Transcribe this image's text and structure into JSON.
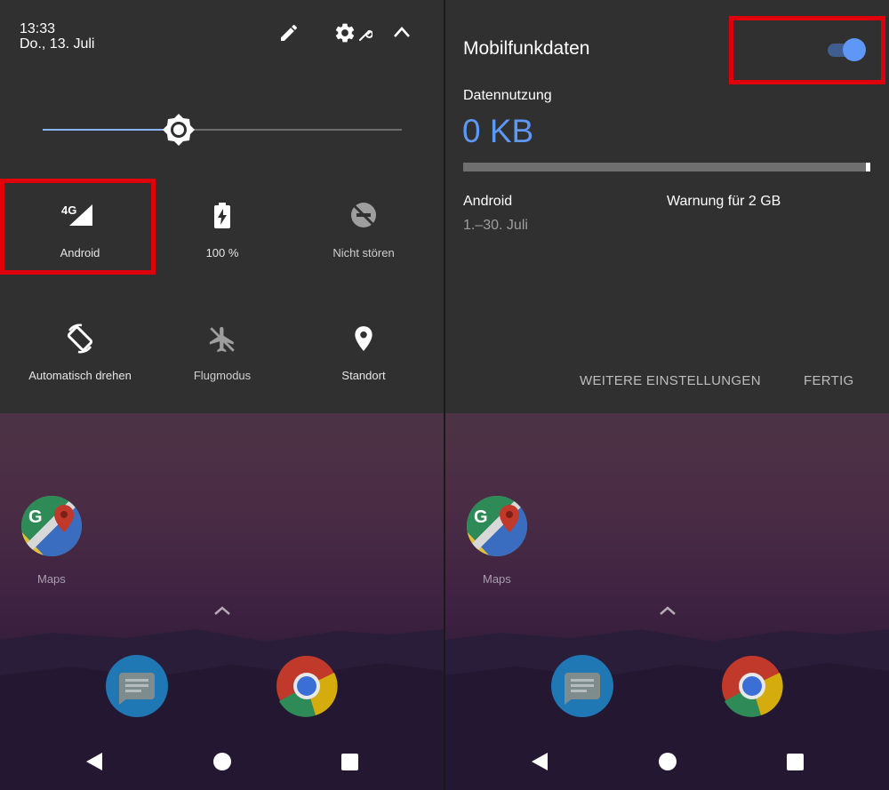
{
  "left": {
    "status": {
      "time": "13:33",
      "date": "Do., 13. Juli"
    },
    "header_icons": [
      "edit-icon",
      "settings-icon",
      "collapse-icon"
    ],
    "brightness": {
      "level": 0.38
    },
    "tiles": [
      {
        "label": "Android",
        "icon": "mobile-data-4g-icon",
        "badge": "4G",
        "highlighted": true
      },
      {
        "label": "100 %",
        "icon": "battery-icon"
      },
      {
        "label": "Nicht stören",
        "icon": "do-not-disturb-icon"
      },
      {
        "label": "Automatisch drehen",
        "icon": "auto-rotate-icon"
      },
      {
        "label": "Flugmodus",
        "icon": "airplane-icon"
      },
      {
        "label": "Standort",
        "icon": "location-icon"
      }
    ]
  },
  "right": {
    "title": "Mobilfunkdaten",
    "toggle": {
      "on": true,
      "highlighted": true
    },
    "usage_label": "Datennutzung",
    "usage_value": "0 KB",
    "usage_fraction": 0.0,
    "network": "Android",
    "period": "1.–30. Juli",
    "warning": "Warnung für 2 GB",
    "actions": {
      "more": "WEITERE EINSTELLUNGEN",
      "done": "FERTIG"
    }
  },
  "home": {
    "app": "Maps",
    "dock": [
      "messages-icon",
      "chrome-icon"
    ],
    "nav": [
      "back-icon",
      "home-icon",
      "recents-icon"
    ]
  },
  "colors": {
    "shade": "#303030",
    "accent": "#5e97f6",
    "highlight": "#e0000b"
  }
}
